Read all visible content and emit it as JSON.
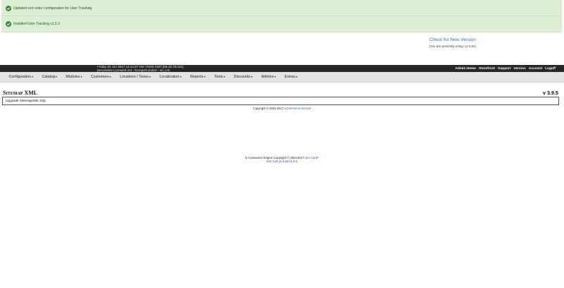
{
  "messages": [
    {
      "text": "Updated sort order configuration for User Tracking"
    },
    {
      "text": "Installed User Tracking v1.5.3"
    }
  ],
  "version_check": {
    "link": "Check for New Version",
    "using": "(You are presently using: v1.5.5e)"
  },
  "header": {
    "datetime": "Friday 30 Jun 2017 11:24:27 AM +0100 GMT [86.16.79.241]",
    "server": "pw-joomla-1.proweb.net - Europe/London - en_US",
    "links": [
      "Admin Home",
      "Storefront",
      "Support",
      "Version",
      "Account",
      "Logoff"
    ]
  },
  "nav": [
    "Configuration",
    "Catalog",
    "Modules",
    "Customers",
    "Locations / Taxes",
    "Localization",
    "Reports",
    "Tools",
    "Discounts",
    "Admins",
    "Extras"
  ],
  "page": {
    "title": "Sitemap XML",
    "version": "v 3.9.5",
    "upgrade_label": "Upgrade SitemapXML SQL",
    "copyright_prefix": "Copyright © 2004-2017",
    "copyright_link": "eCommerce-Service"
  },
  "footer": {
    "line1_prefix": "E-Commerce Engine Copyright © 2003-2017",
    "line1_link": "Zen Cart®",
    "line2": "Zen Cart v1.5.5e/v1.5.5"
  },
  "colors": {
    "message_bg": "#dcefd2",
    "header_bar": "#272727",
    "nav_bg": "#e4e4e4",
    "link": "#3b6fb6"
  }
}
